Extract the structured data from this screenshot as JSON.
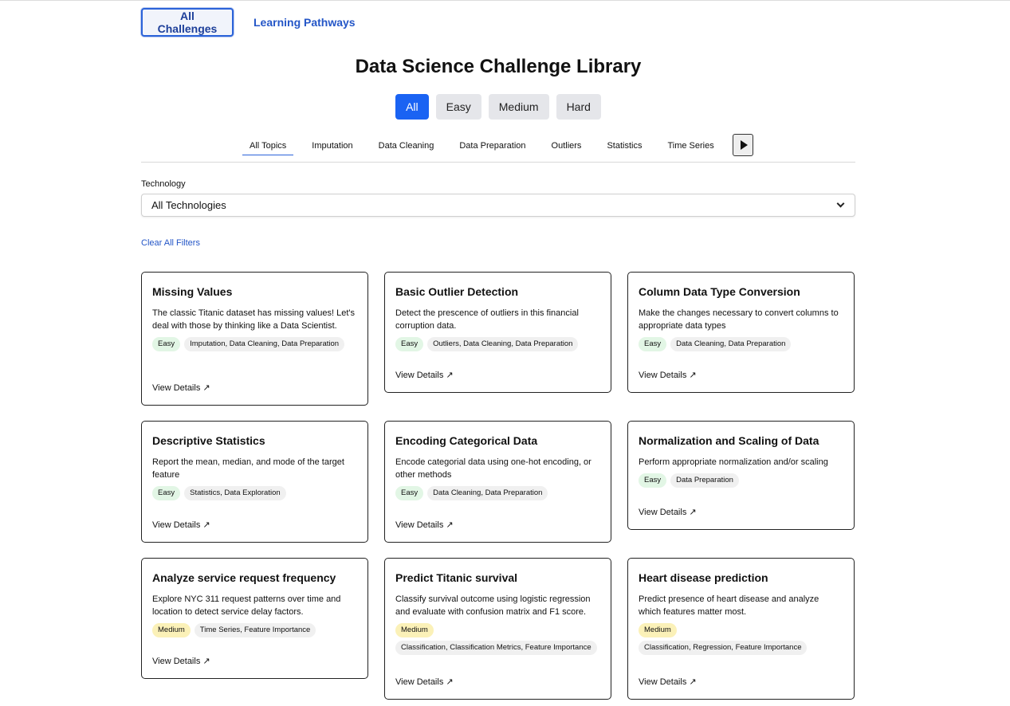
{
  "nav": {
    "all_challenges": "All Challenges",
    "learning_pathways": "Learning Pathways"
  },
  "title": "Data Science Challenge Library",
  "difficulty": {
    "all": "All",
    "easy": "Easy",
    "medium": "Medium",
    "hard": "Hard",
    "selected": "All"
  },
  "topics": {
    "items": [
      "All Topics",
      "Imputation",
      "Data Cleaning",
      "Data Preparation",
      "Outliers",
      "Statistics",
      "Time Series"
    ],
    "selected": "All Topics",
    "next_icon": "play-triangle-icon"
  },
  "technology": {
    "label": "Technology",
    "selected": "All Technologies",
    "chevron_icon": "chevron-down-icon"
  },
  "clear_filters": "Clear All Filters",
  "colors": {
    "accent": "#1a63f3",
    "link": "#2456c7",
    "easy_tag": "#e2f6e5",
    "medium_tag": "#fbf1b8"
  },
  "cards": [
    {
      "title": "Missing Values",
      "description": "The classic Titanic dataset has missing values! Let's deal with those by thinking like a Data Scientist.",
      "difficulty": "Easy",
      "topics": "Imputation, Data Cleaning, Data Preparation",
      "link": "View Details ↗"
    },
    {
      "title": "Basic Outlier Detection",
      "description": "Detect the prescence of outliers in this financial corruption data.",
      "difficulty": "Easy",
      "topics": "Outliers, Data Cleaning, Data Preparation",
      "link": "View Details ↗"
    },
    {
      "title": "Column Data Type Conversion",
      "description": "Make the changes necessary to convert columns to appropriate data types",
      "difficulty": "Easy",
      "topics": "Data Cleaning, Data Preparation",
      "link": "View Details ↗"
    },
    {
      "title": "Descriptive Statistics",
      "description": "Report the mean, median, and mode of the target feature",
      "difficulty": "Easy",
      "topics": "Statistics, Data Exploration",
      "link": "View Details ↗"
    },
    {
      "title": "Encoding Categorical Data",
      "description": "Encode categorial data using one-hot encoding, or other methods",
      "difficulty": "Easy",
      "topics": "Data Cleaning, Data Preparation",
      "link": "View Details ↗"
    },
    {
      "title": "Normalization and Scaling of Data",
      "description": "Perform appropriate normalization and/or scaling",
      "difficulty": "Easy",
      "topics": "Data Preparation",
      "link": "View Details ↗"
    },
    {
      "title": "Analyze service request frequency",
      "description": "Explore NYC 311 request patterns over time and location to detect service delay factors.",
      "difficulty": "Medium",
      "topics": "Time Series, Feature Importance",
      "link": "View Details ↗"
    },
    {
      "title": "Predict Titanic survival",
      "description": "Classify survival outcome using logistic regression and evaluate with confusion matrix and F1 score.",
      "difficulty": "Medium",
      "topics": "Classification, Classification Metrics, Feature Importance",
      "link": "View Details ↗"
    },
    {
      "title": "Heart disease prediction",
      "description": "Predict presence of heart disease and analyze which features matter most.",
      "difficulty": "Medium",
      "topics": "Classification, Regression, Feature Importance",
      "link": "View Details ↗"
    }
  ]
}
